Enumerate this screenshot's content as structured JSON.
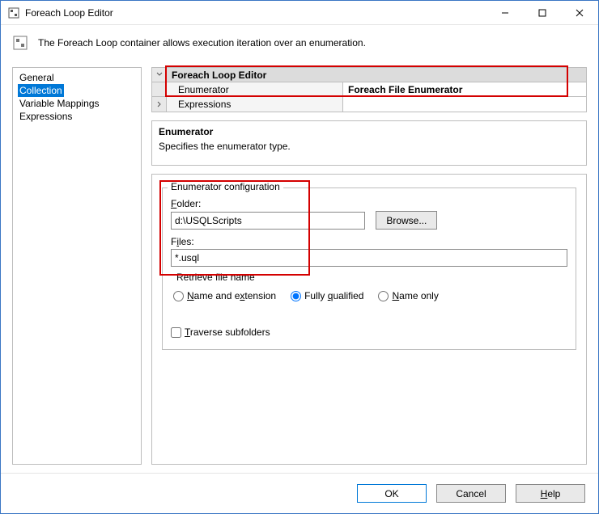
{
  "window": {
    "title": "Foreach Loop Editor"
  },
  "header": {
    "text": "The Foreach Loop container allows execution iteration over an enumeration."
  },
  "nav": {
    "items": [
      {
        "label": "General",
        "selected": false
      },
      {
        "label": "Collection",
        "selected": true
      },
      {
        "label": "Variable Mappings",
        "selected": false
      },
      {
        "label": "Expressions",
        "selected": false
      }
    ]
  },
  "prop_grid": {
    "section_title": "Foreach Loop Editor",
    "enumerator_label": "Enumerator",
    "enumerator_value": "Foreach File Enumerator",
    "expressions_label": "Expressions"
  },
  "prop_desc": {
    "title": "Enumerator",
    "body": "Specifies the enumerator type."
  },
  "config": {
    "legend": "Enumerator configuration",
    "folder_label": "Folder:",
    "folder_value": "d:\\USQLScripts",
    "browse_label": "Browse...",
    "files_label": "Files:",
    "files_value": "*.usql",
    "retrieve_legend": "Retrieve file name",
    "radio": {
      "name_ext": "Name and extension",
      "fully": "Fully qualified",
      "name_only": "Name only",
      "selected": "fully"
    },
    "traverse_label": "Traverse subfolders"
  },
  "footer": {
    "ok": "OK",
    "cancel": "Cancel",
    "help": "Help"
  }
}
